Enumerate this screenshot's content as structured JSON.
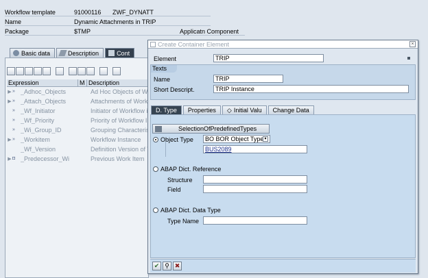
{
  "header": {
    "rows": [
      {
        "label": "Workflow template",
        "value": "91000116",
        "value2": "ZWF_DYNATT"
      },
      {
        "label": "Name",
        "value": "Dynamic Attachments in TRIP"
      },
      {
        "label": "Package",
        "value": "$TMP",
        "extra": "Applicatn Component"
      }
    ]
  },
  "bg_tabs": [
    "Basic data",
    "Description",
    "Cont"
  ],
  "tree": {
    "headers": [
      "Expression",
      "M",
      "Description"
    ],
    "rows": [
      {
        "name": "_Adhoc_Objects",
        "desc": "Ad Hoc Objects of Wo"
      },
      {
        "name": "_Attach_Objects",
        "desc": "Attachments of Workfl"
      },
      {
        "name": "_Wf_Initiator",
        "desc": "Initiator of Workflow in"
      },
      {
        "name": "_Wf_Priority",
        "desc": "Priority of Workflow In"
      },
      {
        "name": "_Wi_Group_ID",
        "desc": "Grouping Characteristi"
      },
      {
        "name": "_Workitem",
        "desc": "Workflow Instance"
      },
      {
        "name": "_Wf_Version",
        "desc": "Definition Version of W"
      },
      {
        "name": "_Predecessor_Wi",
        "desc": "Previous Work Item"
      }
    ]
  },
  "dialog": {
    "title": "Create Container Element",
    "element_label": "Element",
    "element_value": "TRIP",
    "texts_label": "Texts",
    "name_label": "Name",
    "name_value": "TRIP",
    "short_label": "Short Descript.",
    "short_value": "TRIP Instance",
    "tabs": [
      "D. Type",
      "Properties",
      "Initial Valu",
      "Change Data"
    ],
    "select_button": "SelectionOfPredefinedTypes",
    "object_type_label": "Object Type",
    "object_type_dropdown": "BO BOR Object Type",
    "object_type_value": "BUS2089",
    "abap_ref_label": "ABAP Dict. Reference",
    "structure_label": "Structure",
    "field_label": "Field",
    "abap_dt_label": "ABAP Dict. Data Type",
    "type_name_label": "Type Name"
  },
  "colors": {
    "accent_dark": "#34404e",
    "panel": "#c8dcef"
  }
}
